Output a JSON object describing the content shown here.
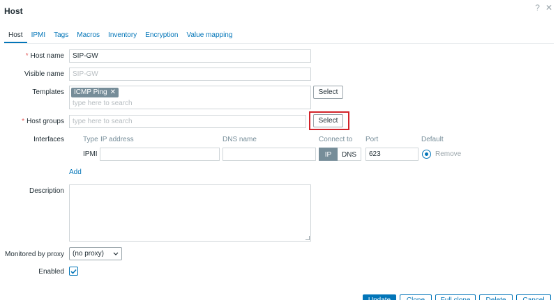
{
  "dialog": {
    "title": "Host"
  },
  "header_icons": {
    "help": "?",
    "close": "✕"
  },
  "tabs": [
    {
      "label": "Host",
      "active": true
    },
    {
      "label": "IPMI",
      "active": false
    },
    {
      "label": "Tags",
      "active": false
    },
    {
      "label": "Macros",
      "active": false
    },
    {
      "label": "Inventory",
      "active": false
    },
    {
      "label": "Encryption",
      "active": false
    },
    {
      "label": "Value mapping",
      "active": false
    }
  ],
  "form": {
    "host_name": {
      "label": "Host name",
      "value": "SIP-GW",
      "required": "*"
    },
    "visible_name": {
      "label": "Visible name",
      "placeholder": "SIP-GW"
    },
    "templates": {
      "label": "Templates",
      "tag": "ICMP Ping",
      "tag_remove": "✕",
      "placeholder": "type here to search",
      "select_label": "Select"
    },
    "host_groups": {
      "label": "Host groups",
      "required": "*",
      "placeholder": "type here to search",
      "select_label": "Select"
    },
    "interfaces": {
      "label": "Interfaces",
      "headers": {
        "type": "Type",
        "ip": "IP address",
        "dns": "DNS name",
        "connect_to": "Connect to",
        "port": "Port",
        "default": "Default"
      },
      "row": {
        "type": "IPMI",
        "ip": "",
        "dns": "",
        "connect_ip": "IP",
        "connect_dns": "DNS",
        "port": "623",
        "remove": "Remove"
      },
      "add_label": "Add"
    },
    "description": {
      "label": "Description",
      "value": ""
    },
    "proxy": {
      "label": "Monitored by proxy",
      "value": "(no proxy)"
    },
    "enabled": {
      "label": "Enabled",
      "checked": true
    }
  },
  "footer": {
    "update": "Update",
    "clone": "Clone",
    "full_clone": "Full clone",
    "delete": "Delete",
    "cancel": "Cancel"
  },
  "colors": {
    "accent": "#0275b8",
    "required": "#e45959",
    "highlight": "#d2232a",
    "tag": "#768d99"
  }
}
